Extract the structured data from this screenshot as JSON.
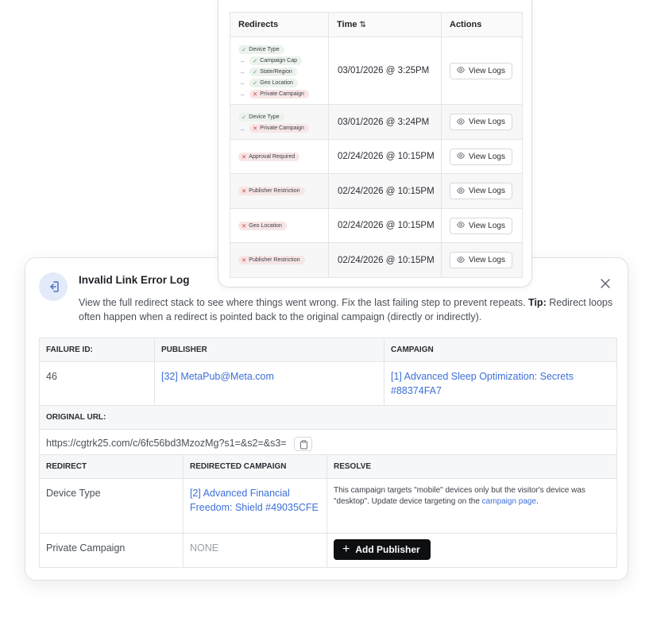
{
  "redirects_table": {
    "headers": {
      "redirects": "Redirects",
      "time": "Time",
      "sort_icon": "⇅",
      "actions": "Actions"
    },
    "view_logs_label": "View Logs",
    "rows": [
      {
        "time": "03/01/2026 @ 3:25PM",
        "steps": [
          {
            "label": "Device Type",
            "status": "pass"
          },
          {
            "label": "Campaign Cap",
            "status": "pass"
          },
          {
            "label": "State/Region",
            "status": "pass"
          },
          {
            "label": "Geo Location",
            "status": "pass"
          },
          {
            "label": "Private Campaign",
            "status": "fail"
          }
        ]
      },
      {
        "time": "03/01/2026 @ 3:24PM",
        "steps": [
          {
            "label": "Device Type",
            "status": "pass"
          },
          {
            "label": "Private Campaign",
            "status": "fail"
          }
        ]
      },
      {
        "time": "02/24/2026 @ 10:15PM",
        "steps": [
          {
            "label": "Approval Required",
            "status": "fail"
          }
        ]
      },
      {
        "time": "02/24/2026 @ 10:15PM",
        "steps": [
          {
            "label": "Publisher Restriction",
            "status": "fail"
          }
        ]
      },
      {
        "time": "02/24/2026 @ 10:15PM",
        "steps": [
          {
            "label": "Geo Location",
            "status": "fail"
          }
        ]
      },
      {
        "time": "02/24/2026 @ 10:15PM",
        "steps": [
          {
            "label": "Publisher Restriction",
            "status": "fail"
          }
        ]
      }
    ]
  },
  "modal": {
    "title": "Invalid Link Error Log",
    "description": "View the full redirect stack to see where things went wrong. Fix the last failing step to prevent repeats.",
    "tip_label": "Tip:",
    "tip_text": "Redirect loops often happen when a redirect is pointed back to the original campaign (directly or indirectly).",
    "failure_id_label": "FAILURE ID:",
    "publisher_label": "PUBLISHER",
    "campaign_label": "CAMPAIGN",
    "failure_id": "46",
    "publisher": "[32] MetaPub@Meta.com",
    "campaign": "[1] Advanced Sleep Optimization: Secrets #88374FA7",
    "original_url_label": "ORIGINAL URL:",
    "original_url": "https://cgtrk25.com/c/6fc56bd3MzozMg?s1=&s2=&s3=",
    "col_redirect": "REDIRECT",
    "col_redirected_campaign": "REDIRECTED CAMPAIGN",
    "col_resolve": "RESOLVE",
    "redirect_rows": [
      {
        "redirect": "Device Type",
        "campaign": "[2] Advanced Financial Freedom: Shield #49035CFE",
        "resolve_text": "This campaign targets \"mobile\" devices only but the visitor's device was \"desktop\". Update device targeting on the",
        "resolve_link": "campaign page",
        "resolve_end": "."
      },
      {
        "redirect": "Private Campaign",
        "campaign": "NONE",
        "button_label": "Add Publisher"
      }
    ]
  },
  "icons": [
    "check-icon",
    "x-icon",
    "arrow-right-icon",
    "eye-icon",
    "sort-icon",
    "exit-icon",
    "close-icon",
    "copy-icon",
    "plus-icon"
  ]
}
